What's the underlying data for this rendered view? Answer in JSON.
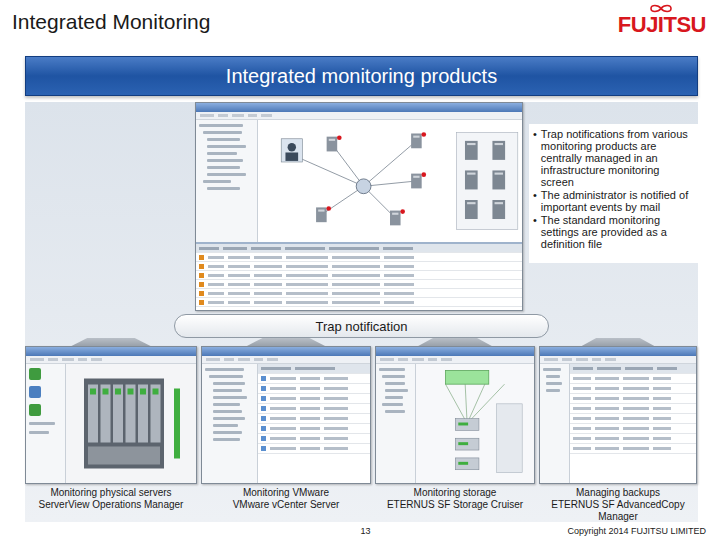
{
  "header": {
    "title": "Integrated Monitoring",
    "logo": "FUJITSU"
  },
  "banner": {
    "title": "Integrated monitoring products"
  },
  "bullet_mark": "•",
  "bullets": [
    "Trap notifications from various monitoring products are centrally managed in an infrastructure monitoring screen",
    "The administrator is notified of important events by mail",
    "The standard monitoring settings are provided as a definition file"
  ],
  "trap": {
    "label": "Trap notification"
  },
  "products": [
    {
      "title": "Monitoring physical servers",
      "product": "ServerView Operations Manager",
      "kind": "server"
    },
    {
      "title": "Monitoring VMware",
      "product": "VMware vCenter Server",
      "kind": "vmware"
    },
    {
      "title": "Monitoring storage",
      "product": "ETERNUS SF Storage Cruiser",
      "kind": "storage"
    },
    {
      "title": "Managing backups",
      "product": "ETERNUS SF AdvancedCopy Manager",
      "kind": "backup"
    }
  ],
  "footer": {
    "page": "13",
    "copyright": "Copyright 2014 FUJITSU LIMITED"
  }
}
